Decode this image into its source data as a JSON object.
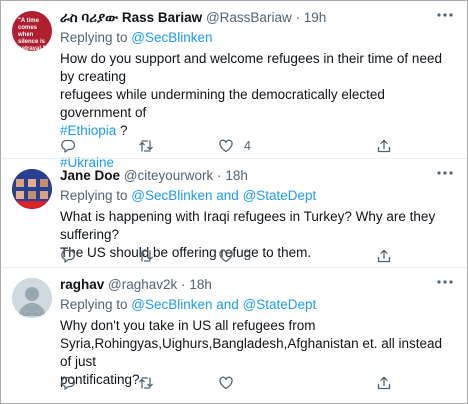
{
  "tweets": [
    {
      "name": "ራስ ባሪያው  Rass Bariaw",
      "handle": "@RassBariaw",
      "time": "19h",
      "replying_prefix": "Replying to ",
      "replying_to": "@SecBlinken",
      "text_line1": "How do you support and welcome refugees in their time of need by creating",
      "text_line2": "refugees while undermining the democratically elected government of",
      "hashtag_ethiopia": "#Ethiopia",
      "text_q": " ?",
      "hashtag_ukraine": "#Ukraine",
      "avatar_text": "\"A time comes when silence is betrayal.\"",
      "likes": "4"
    },
    {
      "name": "Jane Doe",
      "handle": "@citeyourwork",
      "time": "18h",
      "replying_prefix": "Replying to ",
      "replying_to": "@SecBlinken and @StateDept",
      "text_line1": "What is happening with Iraqi refugees in Turkey? Why are they suffering?",
      "text_line2": "The US should be offering refuge to them.",
      "likes": "3"
    },
    {
      "name": "raghav",
      "handle": "@raghav2k",
      "time": "18h",
      "replying_prefix": "Replying to ",
      "replying_to": "@SecBlinken and @StateDept",
      "text_line1": "Why don't you take in  US all refugees from",
      "text_line2": "Syria,Rohingyas,Uighurs,Bangladesh,Afghanistan et. all instead of just",
      "text_line3": "pontificating?"
    }
  ],
  "separator": "·",
  "icons": [
    "reply-icon",
    "retweet-icon",
    "like-icon",
    "share-icon",
    "more-icon"
  ],
  "colors": {
    "link": "#1d9bf0",
    "muted": "#536471",
    "text": "#0f1419"
  }
}
